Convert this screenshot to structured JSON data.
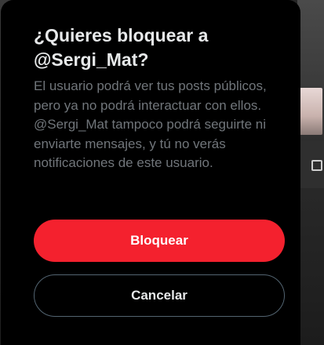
{
  "dialog": {
    "title": "¿Quieres bloquear a @Sergi_Mat?",
    "body": "El usuario podrá ver tus posts públicos, pero ya no podrá interactuar con ellos. @Sergi_Mat tampoco podrá seguirte ni enviarte mensajes, y tú no verás notificaciones de este usuario.",
    "confirm_label": "Bloquear",
    "cancel_label": "Cancelar"
  },
  "colors": {
    "dialog_bg": "#000000",
    "title_text": "#e7e9ea",
    "body_text": "#71767b",
    "danger": "#f4212e",
    "cancel_border": "#536471"
  }
}
